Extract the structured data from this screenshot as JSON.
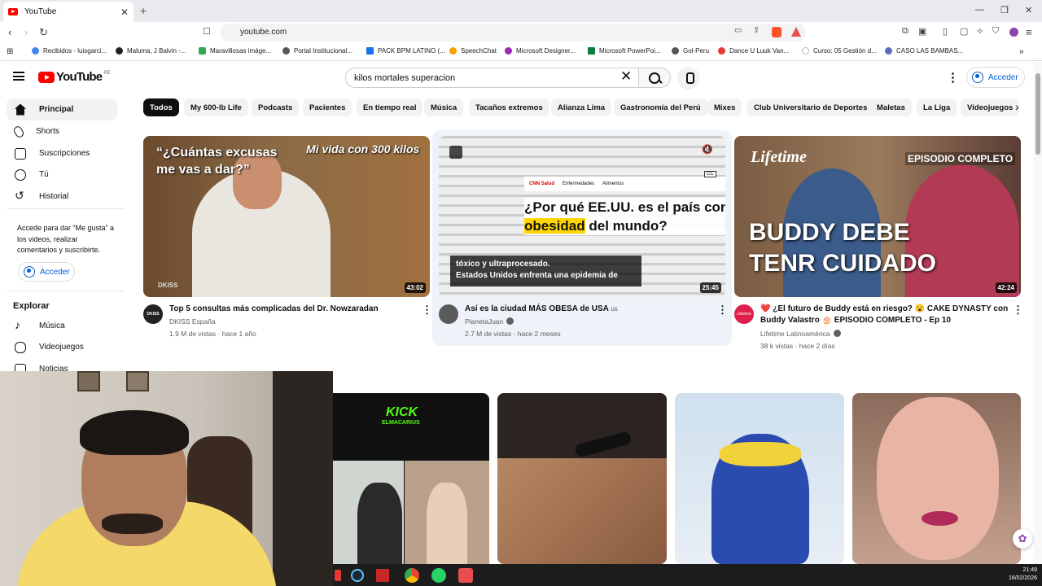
{
  "browser": {
    "tab_title": "YouTube",
    "tab_close": "✕",
    "new_tab": "+",
    "url": "youtube.com",
    "window_controls": [
      "—",
      "❐",
      "✕"
    ],
    "bookmarks": [
      {
        "label": "Recibidos - luisgarci...",
        "color": "#4285f4"
      },
      {
        "label": "Maluma, J Balvin -...",
        "color": "#222222"
      },
      {
        "label": "Maravillosas imáge...",
        "color": "#34a853"
      },
      {
        "label": "Portal Institucional...",
        "color": "#555555"
      },
      {
        "label": "PACK BPM LATINO (...",
        "color": "#1a73e8"
      },
      {
        "label": "SpeechChat",
        "color": "#f4a300"
      },
      {
        "label": "Microsoft Designer...",
        "color": "#9c27b0"
      },
      {
        "label": "Microsoft PowerPoi...",
        "color": "#107c41"
      },
      {
        "label": "Gol-Peru",
        "color": "#555555"
      },
      {
        "label": "Dance U Luuk Van...",
        "color": "#e53935"
      },
      {
        "label": "Curso: 05 Gestión d...",
        "color": "#bbbbbb"
      },
      {
        "label": "CASO LAS BAMBAS...",
        "color": "#5c6bc0"
      }
    ],
    "bookmarks_more": "»"
  },
  "header": {
    "logo_text": "YouTube",
    "country": "PE",
    "search_value": "kilos mortales superacion",
    "clear_icon": "✕",
    "more_icon": "⋮",
    "signin_label": "Acceder"
  },
  "sidebar": {
    "items": [
      {
        "label": "Principal",
        "icon": "home-icon"
      },
      {
        "label": "Shorts",
        "icon": "shorts-icon"
      },
      {
        "label": "Suscripciones",
        "icon": "subscriptions-icon"
      },
      {
        "label": "Tú",
        "icon": "you-icon"
      },
      {
        "label": "Historial",
        "icon": "history-icon"
      }
    ],
    "signin_prompt": "Accede para dar “Me gusta” a los videos, realizar comentarios y suscribirte.",
    "signin_label": "Acceder",
    "explore_title": "Explorar",
    "explore_items": [
      {
        "label": "Música",
        "icon": "music-icon"
      },
      {
        "label": "Videojuegos",
        "icon": "gaming-icon"
      },
      {
        "label": "Noticias",
        "icon": "news-icon"
      }
    ]
  },
  "chips": [
    "Todos",
    "My 600-lb Life",
    "Podcasts",
    "Pacientes",
    "En tiempo real",
    "Música",
    "Tacaños extremos",
    "Alianza Lima",
    "Gastronomía del Perú",
    "Mixes",
    "Club Universitario de Deportes",
    "Maletas",
    "La Liga",
    "Videojuegos"
  ],
  "chip_next": "›",
  "videos": [
    {
      "title": "Top 5 consultas más complicadas del Dr. Nowzaradan",
      "channel": "DKISS España",
      "meta": "1.9 M de vistas · hace 1 año",
      "duration": "43:02",
      "thumb_text": "“¿Cuántas excusas me vas a dar?”",
      "thumb_text2": "Mi vida con 300 kilos",
      "thumb_brand": "DKISS",
      "avatar_text": "DKISS"
    },
    {
      "title": "Así es la ciudad MÁS OBESA de USA",
      "title_flag": "us",
      "channel": "PlanetaJuan",
      "meta": "2.7 M de vistas · hace 2 meses",
      "duration": "25:45",
      "thumb_headline": "¿Por qué EE.UU. es el país con",
      "thumb_highlight": "obesidad",
      "thumb_headline_end": "del mundo?",
      "thumb_caption1": "tóxico y ultraprocesado.",
      "thumb_caption2": "Estados Unidos enfrenta una epidemia de",
      "thumb_nav": [
        "CNN Salud",
        "Enfermedades",
        "Alimentos"
      ],
      "thumb_cc": "CC"
    },
    {
      "title": "❤️ ¿El futuro de Buddy está en riesgo? 😮 CAKE DYNASTY con Buddy Valastro 🎂 EPISODIO COMPLETO - Ep 10",
      "channel": "Lifetime Latinoamérica",
      "meta": "38 k vistas · hace 2 días",
      "duration": "42:24",
      "thumb_brand": "Lifetime",
      "thumb_badge": "EPISODIO COMPLETO",
      "thumb_text": "BUDDY DEBE TENR CUIDADO",
      "avatar_text": "Lifetime"
    }
  ],
  "second_row_thumb": {
    "brand": "KICK",
    "sub": "ELMACARIUS"
  },
  "taskbar": {
    "time": "21:49",
    "date": "16/02/2026"
  },
  "colors": {
    "accent": "#065fd4",
    "brand_red": "#ff0000",
    "chip_bg": "#f2f2f2"
  }
}
